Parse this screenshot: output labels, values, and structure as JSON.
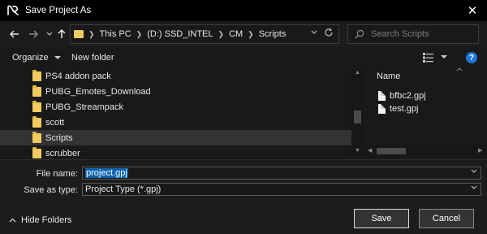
{
  "window": {
    "title": "Save Project As",
    "close_glyph": "✕"
  },
  "nav": {
    "back_icon": "arrow-left-icon",
    "forward_icon": "arrow-right-icon",
    "recent_icon": "chevron-down-icon",
    "up_icon": "arrow-up-icon"
  },
  "address": {
    "crumbs": [
      "This PC",
      "(D:) SSD_INTEL",
      "CM",
      "Scripts"
    ]
  },
  "search": {
    "placeholder": "Search Scripts"
  },
  "toolbar": {
    "organize_label": "Organize",
    "new_folder_label": "New folder",
    "help_label": "?"
  },
  "tree": {
    "items": [
      {
        "label": "PS4 addon pack",
        "selected": false
      },
      {
        "label": "PUBG_Emotes_Download",
        "selected": false
      },
      {
        "label": "PUBG_Streampack",
        "selected": false
      },
      {
        "label": "scott",
        "selected": false
      },
      {
        "label": "Scripts",
        "selected": true
      },
      {
        "label": "scrubber",
        "selected": false
      }
    ]
  },
  "files": {
    "column_name": "Name",
    "items": [
      {
        "name": "bfbc2.gpj"
      },
      {
        "name": "test.gpj"
      }
    ]
  },
  "form": {
    "file_name_label": "File name:",
    "file_name_value": "project.gpj",
    "save_type_label": "Save as type:",
    "save_type_value": "Project Type (*.gpj)"
  },
  "footer": {
    "hide_folders_label": "Hide Folders",
    "save_label": "Save",
    "cancel_label": "Cancel"
  },
  "colors": {
    "accent": "#1e76d6",
    "folder": "#f1cb5f",
    "selection": "#0a64ad"
  }
}
